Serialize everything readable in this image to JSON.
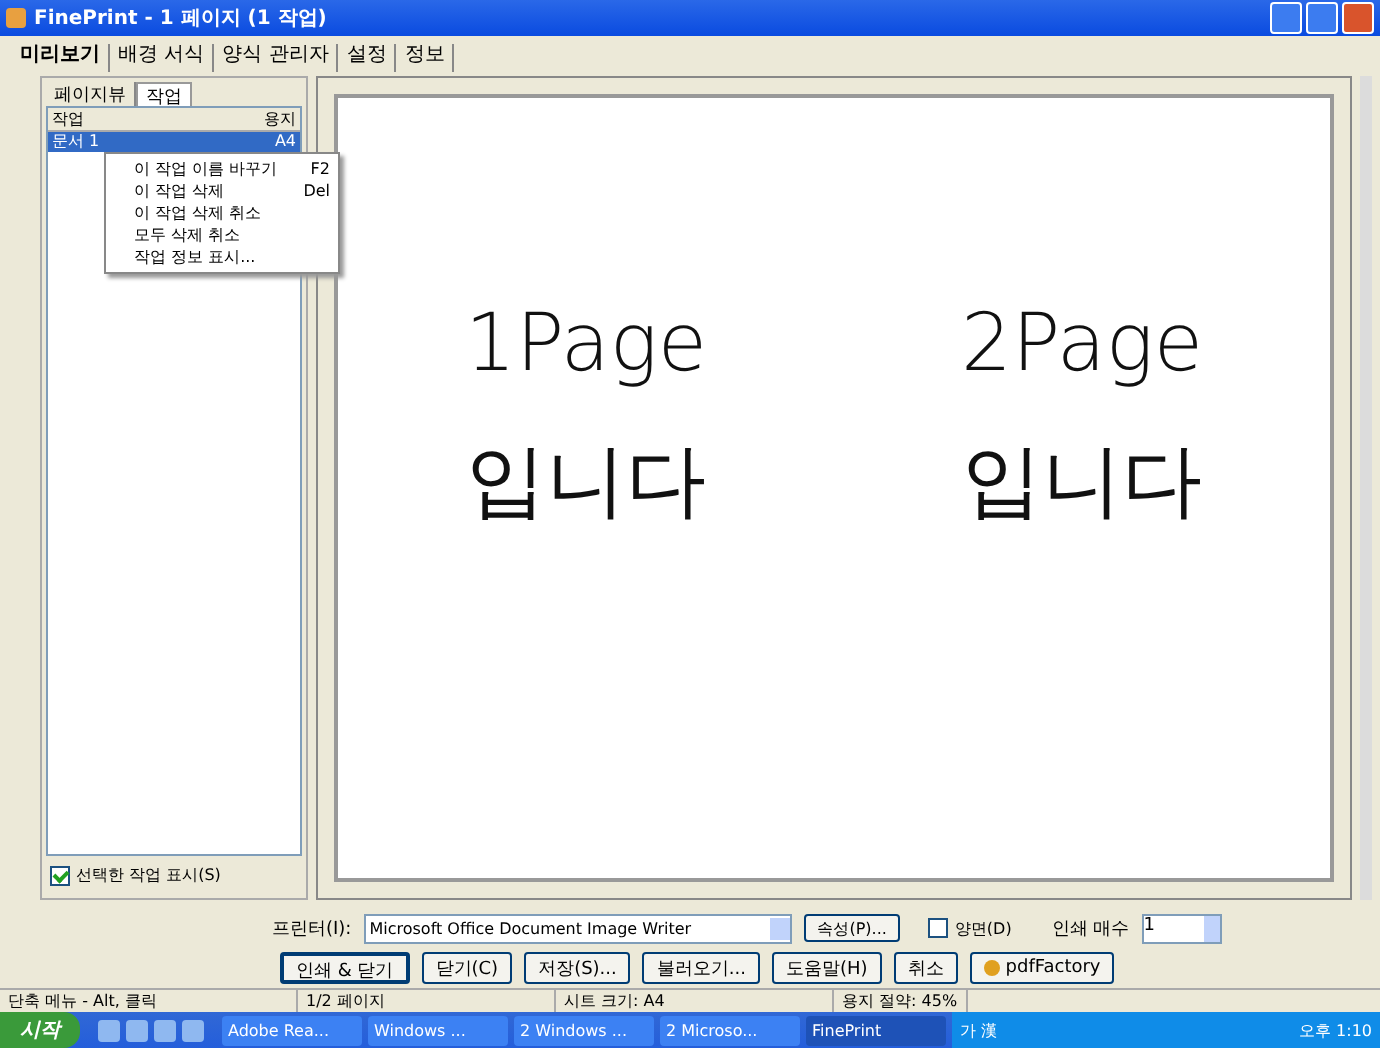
{
  "window": {
    "title": "FinePrint - 1 페이지 (1 작업)"
  },
  "tabs": [
    {
      "label": "미리보기",
      "selected": true
    },
    {
      "label": "배경 서식",
      "selected": false
    },
    {
      "label": "양식 관리자",
      "selected": false
    },
    {
      "label": "설정",
      "selected": false
    },
    {
      "label": "정보",
      "selected": false
    }
  ],
  "sub_tabs": [
    {
      "label": "페이지뷰",
      "selected": false
    },
    {
      "label": "작업",
      "selected": true
    }
  ],
  "job_list": {
    "columns": [
      "작업",
      "용지"
    ],
    "rows": [
      {
        "name": "문서 1",
        "paper": "A4",
        "selected": true
      }
    ]
  },
  "context_menu": [
    {
      "label": "이 작업 이름 바꾸기",
      "shortcut": "F2"
    },
    {
      "label": "이 작업 삭제",
      "shortcut": "Del"
    },
    {
      "label": "이 작업 삭제 취소"
    },
    {
      "label": "모두 삭제 취소"
    },
    {
      "label": "작업 정보 표시..."
    }
  ],
  "show_selected_job": {
    "label": "선택한 작업 표시(S)",
    "checked": true
  },
  "pages": [
    {
      "line1": "1Page",
      "line2": "입니다"
    },
    {
      "line1": "2Page",
      "line2": "입니다"
    }
  ],
  "printer": {
    "label": "프린터(I):",
    "value": "Microsoft Office Document Image Writer",
    "properties": "속성(P)...",
    "duplex": {
      "label": "양면(D)",
      "checked": false
    },
    "copies_label": "인쇄 매수",
    "copies": "1"
  },
  "buttons": [
    {
      "label": "인쇄 & 닫기",
      "kind": "default"
    },
    {
      "label": "닫기(C)",
      "kind": "plain"
    },
    {
      "label": "저장(S)...",
      "kind": "plain"
    },
    {
      "label": "불러오기...",
      "kind": "plain"
    },
    {
      "label": "도움말(H)",
      "kind": "plain"
    },
    {
      "label": "취소",
      "kind": "plain"
    },
    {
      "label": "pdfFactory",
      "kind": "icon"
    }
  ],
  "status_bar": [
    "단축 메뉴 - Alt, 클릭",
    "1/2 페이지",
    "시트 크기: A4",
    "용지 절약: 45%"
  ],
  "taskbar": {
    "start": "시작",
    "items": [
      {
        "label": "Adobe Rea...",
        "selected": false
      },
      {
        "label": "Windows ...",
        "selected": false
      },
      {
        "label": "2 Windows ...",
        "selected": false
      },
      {
        "label": "2 Microso...",
        "selected": false
      },
      {
        "label": "FinePrint",
        "selected": true
      }
    ],
    "tray": "가 漢",
    "clock": "오후 1:10"
  }
}
